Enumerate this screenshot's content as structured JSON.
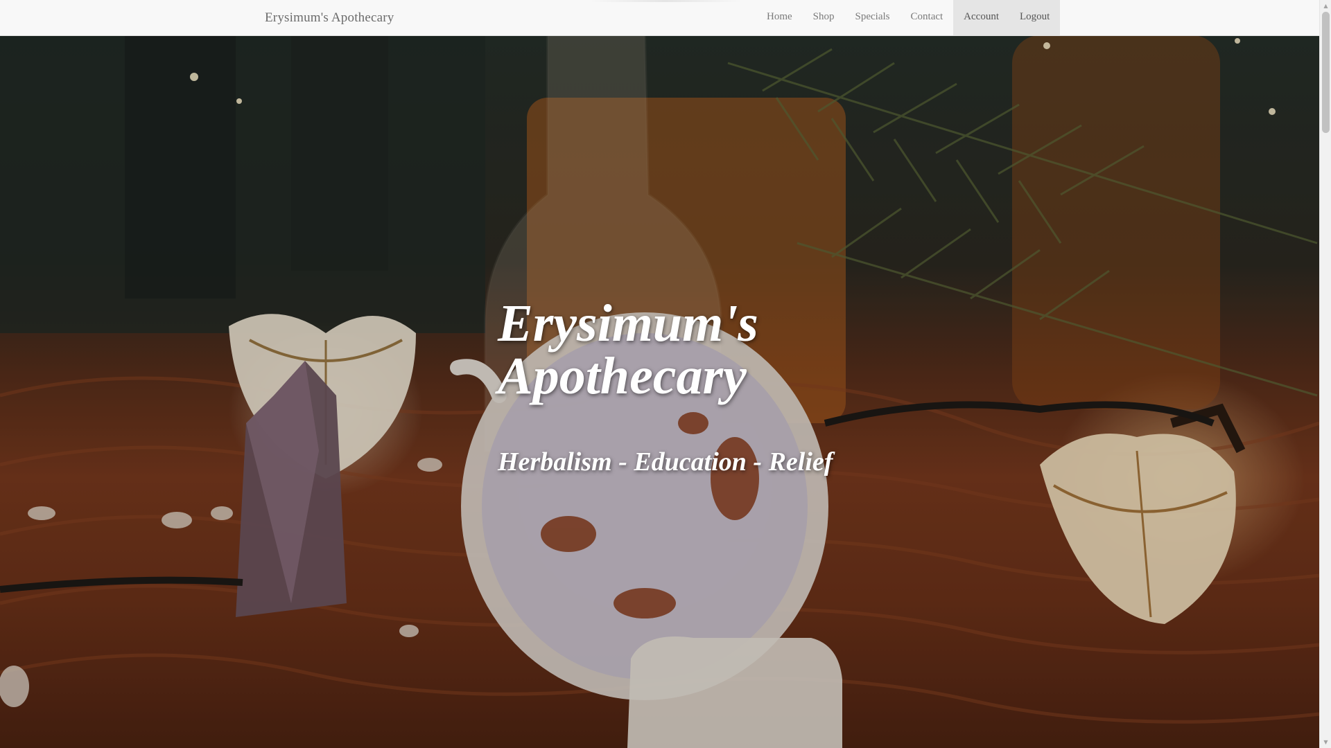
{
  "navbar": {
    "brand": "Erysimum's Apothecary",
    "items": [
      {
        "label": "Home",
        "active": false
      },
      {
        "label": "Shop",
        "active": false
      },
      {
        "label": "Specials",
        "active": false
      },
      {
        "label": "Contact",
        "active": false
      },
      {
        "label": "Account",
        "active": true
      },
      {
        "label": "Logout",
        "active": false
      }
    ]
  },
  "hero": {
    "title": "Erysimum's Apothecary",
    "subtitle": "Herbalism - Education - Relief",
    "image_description_icons": [
      "amethyst-crystal",
      "tulip-lamp",
      "tea-cup",
      "glass-bottle",
      "pine-branch"
    ]
  },
  "scrollbar": {
    "up_icon": "triangle-up-icon",
    "down_icon": "triangle-down-icon"
  },
  "colors": {
    "navbar_bg": "#f8f8f8",
    "nav_active_bg": "#e5e5e5",
    "nav_text": "#7a7a7a",
    "hero_text": "#ffffff",
    "knit_orange": "#7a3a1e"
  }
}
